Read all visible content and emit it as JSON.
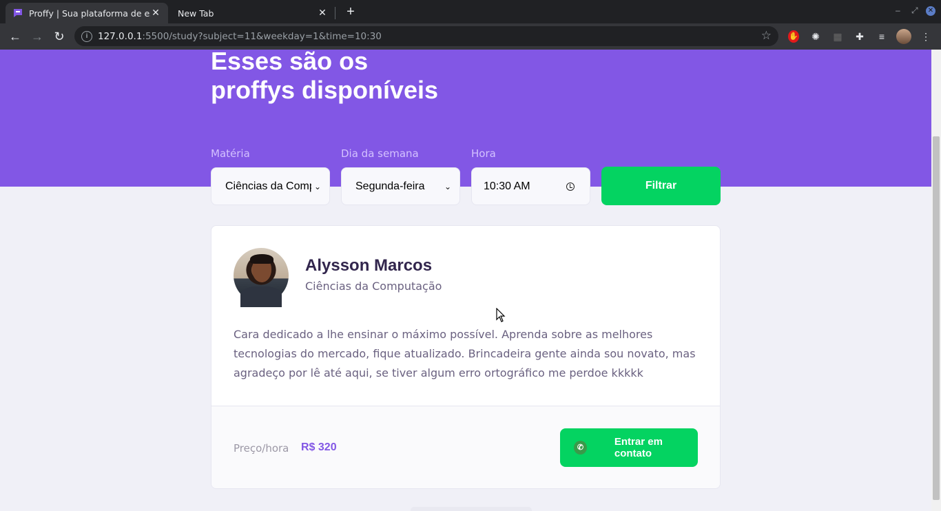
{
  "browser": {
    "tabs": [
      {
        "title": "Proffy | Sua plataforma de estudos",
        "active": true
      },
      {
        "title": "New Tab",
        "active": false
      }
    ],
    "url_host": "127.0.0.1",
    "url_rest": ":5500/study?subject=11&weekday=1&time=10:30",
    "new_tab": "+",
    "close": "✕"
  },
  "hero": {
    "title_line1": "Esses são os",
    "title_line2": "proffys disponíveis"
  },
  "filters": {
    "subject_label": "Matéria",
    "subject_value": "Ciências da Computação",
    "weekday_label": "Dia da semana",
    "weekday_value": "Segunda-feira",
    "time_label": "Hora",
    "time_value": "10:30  AM",
    "submit_label": "Filtrar"
  },
  "teacher": {
    "name": "Alysson Marcos",
    "subject": "Ciências da Computação",
    "bio": "Cara dedicado a lhe ensinar o máximo possível. Aprenda sobre as melhores tecnologias do mercado, fique atualizado. Brincadeira gente ainda sou novato, mas agradeço por lê até aqui, se tiver algum erro ortográfico me perdoe kkkkk",
    "price_label": "Preço/hora",
    "price_value": "R$ 320",
    "contact_label": "Entrar em contato"
  },
  "colors": {
    "primary": "#8257e5",
    "secondary": "#04d361",
    "background": "#f0f0f7"
  }
}
